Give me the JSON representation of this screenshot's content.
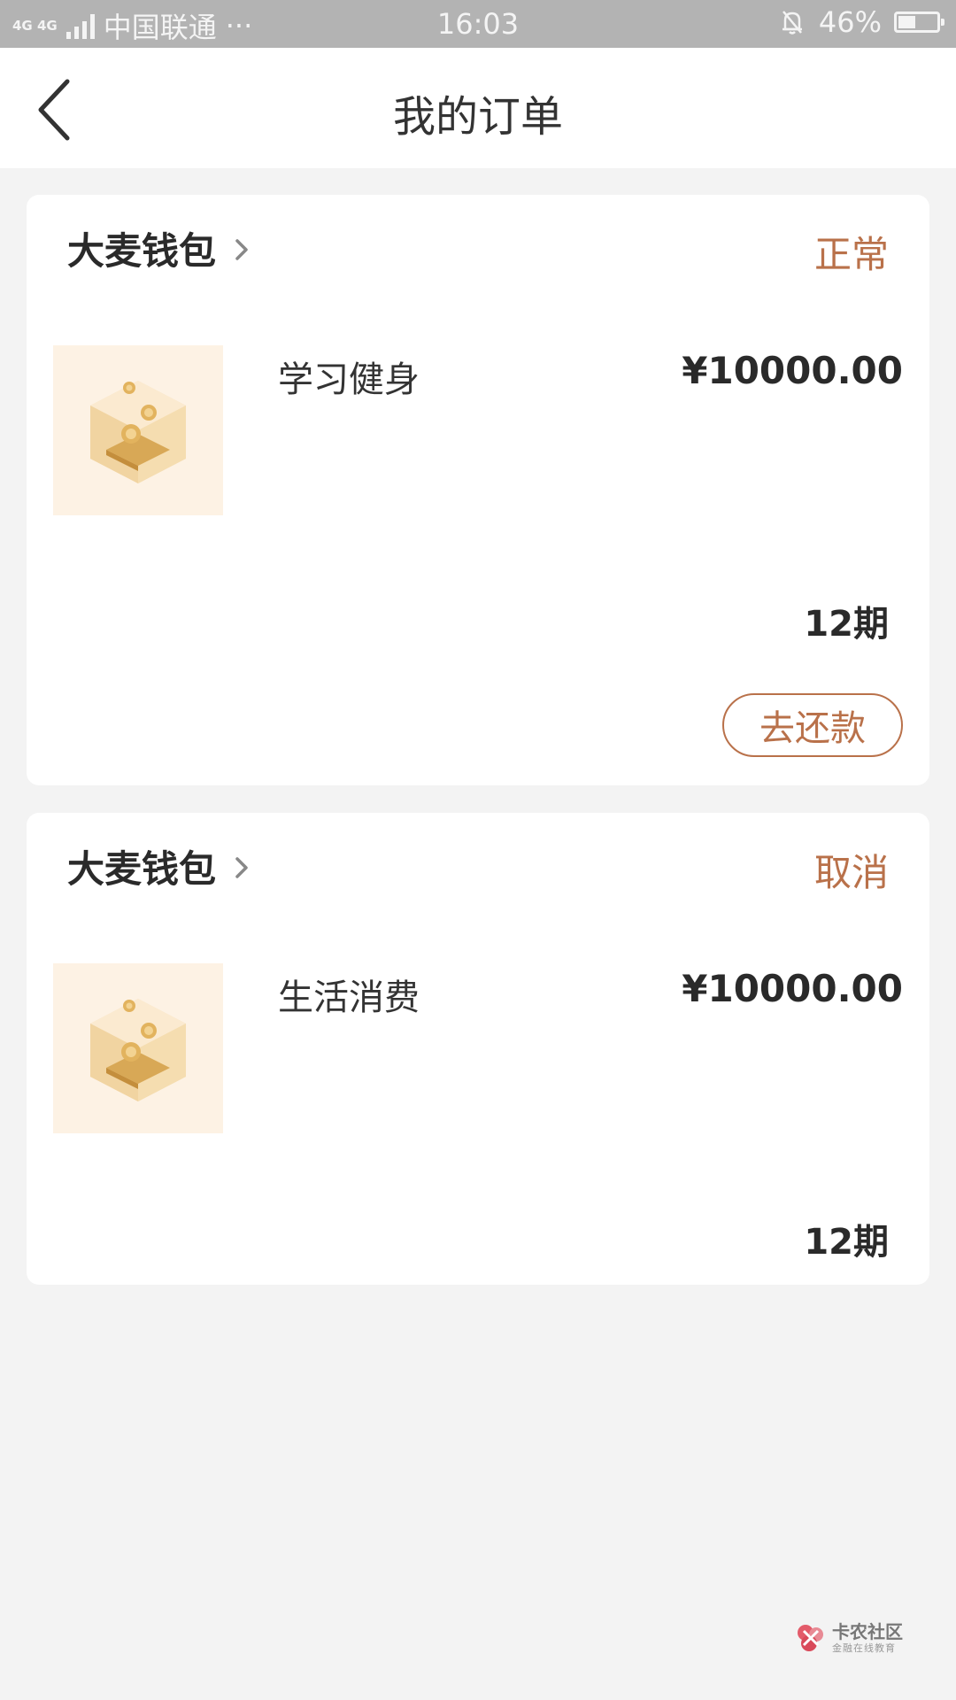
{
  "status_bar": {
    "network": "4G 4G",
    "carrier": "中国联通",
    "dots": "···",
    "time": "16:03",
    "battery_percent": "46%",
    "battery_level": 0.46
  },
  "header": {
    "title": "我的订单",
    "back_icon": "back-arrow-icon"
  },
  "orders": [
    {
      "merchant": "大麦钱包",
      "status": "正常",
      "product": "学习健身",
      "price": "¥10000.00",
      "periods": "12期",
      "action_label": "去还款"
    },
    {
      "merchant": "大麦钱包",
      "status": "取消",
      "product": "生活消费",
      "price": "¥10000.00",
      "periods": "12期"
    }
  ],
  "watermark": {
    "title": "卡农社区",
    "subtitle": "金融在线教育"
  },
  "colors": {
    "accent": "#b9714a",
    "background": "#f3f3f3",
    "status_bar": "#b3b3b3"
  }
}
